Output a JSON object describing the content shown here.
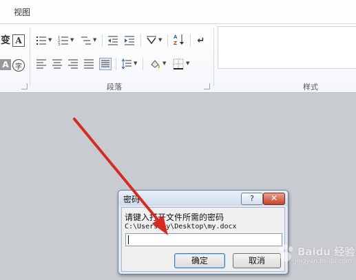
{
  "menu": {
    "tab_view": "视图"
  },
  "ribbon": {
    "group_paragraph": "段落",
    "group_styles": "样式",
    "font_glyph_1": "变",
    "font_glyph_2": "A",
    "font_glyph_3": "A",
    "font_glyph_4": "字"
  },
  "dialog": {
    "title": "密码",
    "help_label": "?",
    "close_label": "✕",
    "prompt": "请键入打开文件所需的密码",
    "file_path": "C:\\Users\\my\\Desktop\\my.docx",
    "password_value": "",
    "ok_label": "确定",
    "cancel_label": "取消"
  },
  "watermark": {
    "text": "Baidu 经验",
    "url": "jingyan.baidu.com"
  },
  "colors": {
    "annotation_arrow": "#d62b22"
  }
}
